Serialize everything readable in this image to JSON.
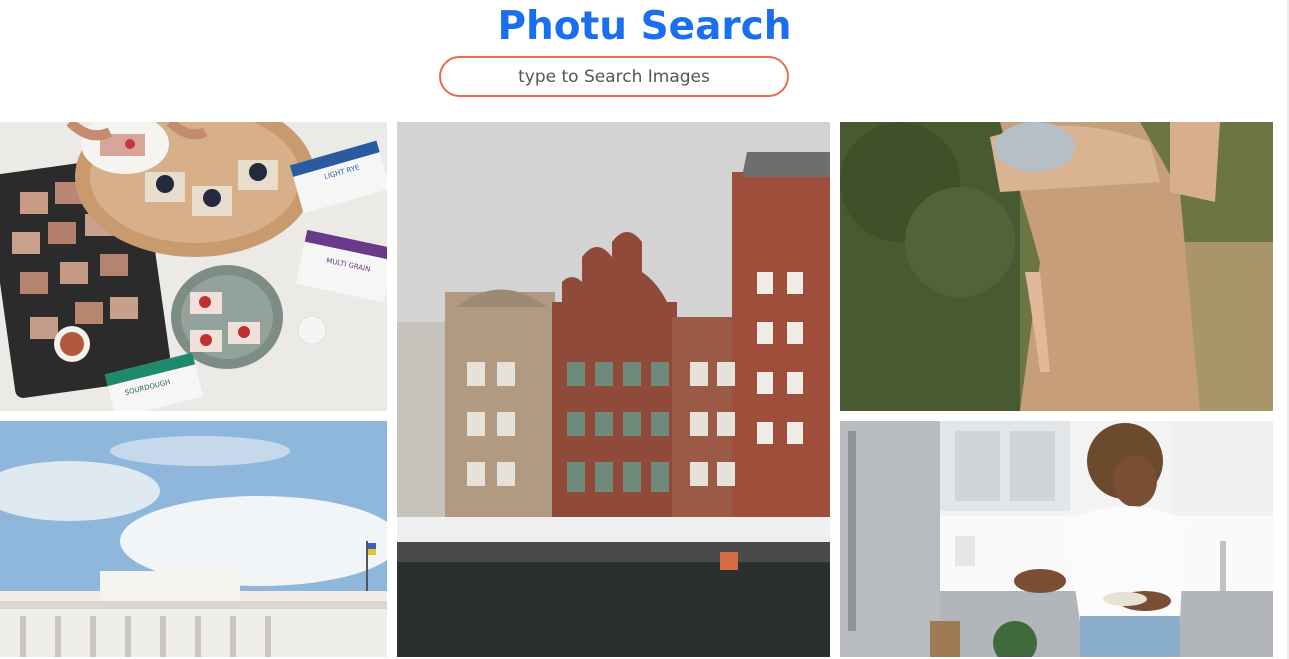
{
  "header": {
    "title": "Photu Search",
    "title_color": "#1a6ef0"
  },
  "search": {
    "placeholder": "type to Search Images",
    "value": "",
    "border_color": "#ea6a50"
  },
  "results": [
    {
      "id": "crispbread-snack-board",
      "labels": [
        "LIGHT RYE",
        "MULTI GRAIN",
        "SOURDOUGH"
      ]
    },
    {
      "id": "gdansk-canal-buildings",
      "labels": []
    },
    {
      "id": "mother-holding-baby-field",
      "labels": []
    },
    {
      "id": "white-palace-under-sky",
      "labels": []
    },
    {
      "id": "woman-in-kitchen",
      "labels": []
    }
  ]
}
